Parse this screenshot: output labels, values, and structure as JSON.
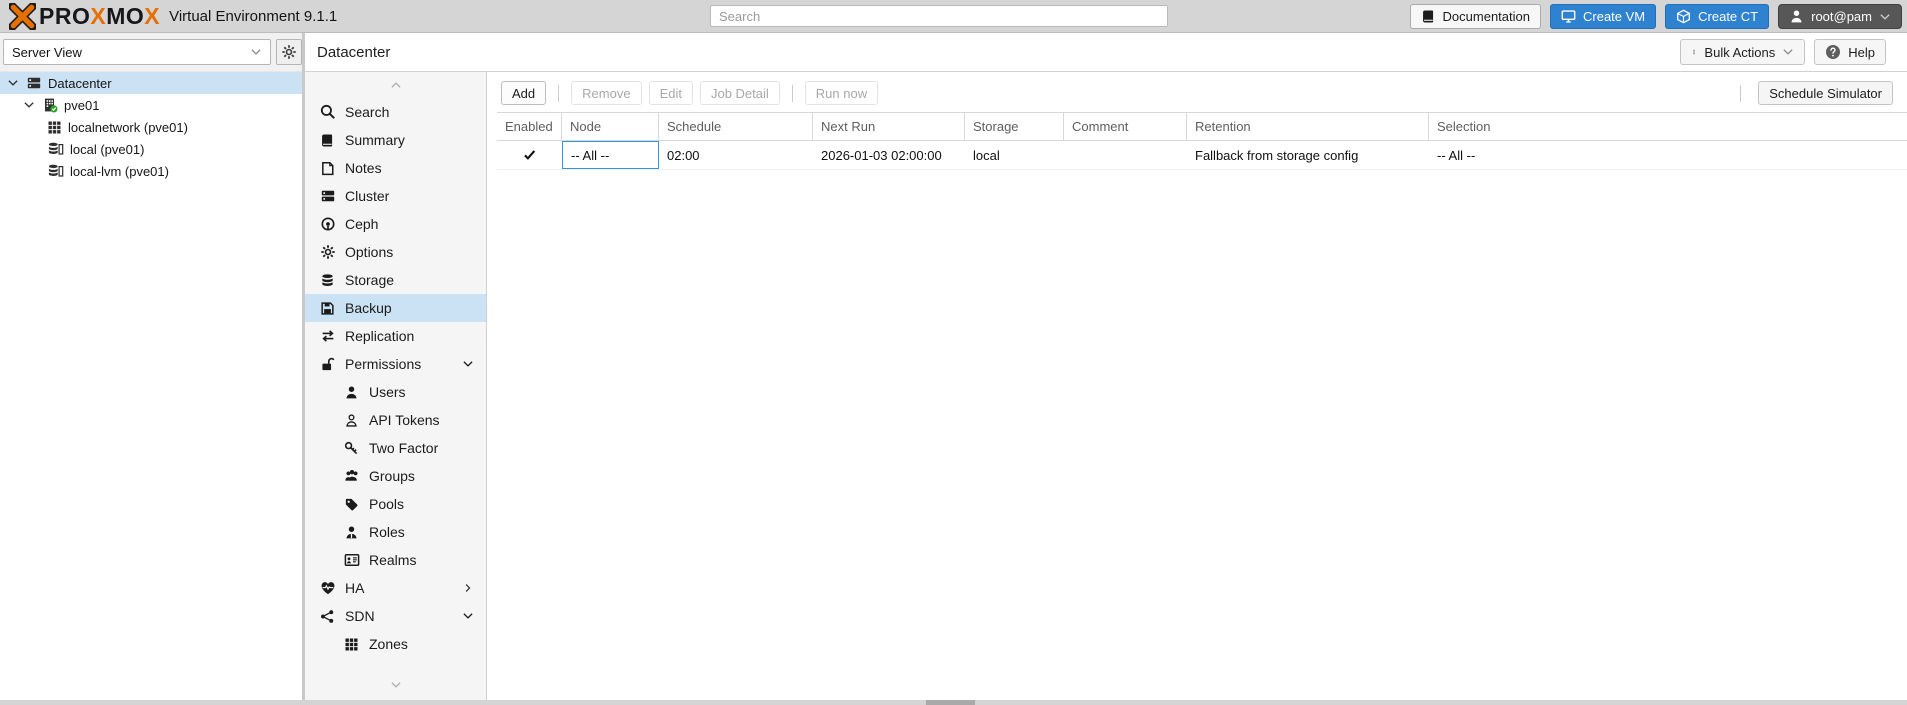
{
  "brand": {
    "logo_mark_icon": "proxmox-x-logo",
    "word_p1": "PRO",
    "word_p2": "X",
    "word_p3": "MO",
    "word_p4": "X",
    "subtitle": "Virtual Environment 9.1.1"
  },
  "topbar": {
    "search_placeholder": "Search",
    "documentation_label": "Documentation",
    "create_vm_label": "Create VM",
    "create_ct_label": "Create CT",
    "user_label": "root@pam"
  },
  "left_panel": {
    "view_selector": "Server View",
    "gear_icon": "gear-icon",
    "tree": [
      {
        "label": "Datacenter",
        "icon": "server-icon",
        "selected": true,
        "expanded": true
      },
      {
        "label": "pve01",
        "icon": "node-online-icon",
        "expanded": true
      },
      {
        "label": "localnetwork (pve01)",
        "icon": "network-grid-icon"
      },
      {
        "label": "local (pve01)",
        "icon": "storage-disk-icon"
      },
      {
        "label": "local-lvm (pve01)",
        "icon": "storage-disk-icon"
      }
    ]
  },
  "content_header": {
    "title": "Datacenter",
    "bulk_actions_label": "Bulk Actions",
    "help_label": "Help"
  },
  "nav": {
    "items": [
      {
        "label": "Search",
        "icon": "search-icon"
      },
      {
        "label": "Summary",
        "icon": "book-icon"
      },
      {
        "label": "Notes",
        "icon": "note-icon"
      },
      {
        "label": "Cluster",
        "icon": "cluster-icon"
      },
      {
        "label": "Ceph",
        "icon": "ceph-icon"
      },
      {
        "label": "Options",
        "icon": "gear-icon"
      },
      {
        "label": "Storage",
        "icon": "storage-icon"
      },
      {
        "label": "Backup",
        "icon": "backup-icon",
        "selected": true
      },
      {
        "label": "Replication",
        "icon": "replication-icon"
      },
      {
        "label": "Permissions",
        "icon": "unlock-icon",
        "arrow": "down"
      },
      {
        "label": "Users",
        "icon": "user-icon",
        "indent": true
      },
      {
        "label": "API Tokens",
        "icon": "user-outline-icon",
        "indent": true
      },
      {
        "label": "Two Factor",
        "icon": "key-icon",
        "indent": true
      },
      {
        "label": "Groups",
        "icon": "users-icon",
        "indent": true
      },
      {
        "label": "Pools",
        "icon": "tag-icon",
        "indent": true
      },
      {
        "label": "Roles",
        "icon": "role-icon",
        "indent": true
      },
      {
        "label": "Realms",
        "icon": "id-card-icon",
        "indent": true
      },
      {
        "label": "HA",
        "icon": "heartbeat-icon",
        "arrow": "right"
      },
      {
        "label": "SDN",
        "icon": "sdn-icon",
        "arrow": "down"
      },
      {
        "label": "Zones",
        "icon": "grid-icon",
        "indent": true
      }
    ]
  },
  "toolbar": {
    "add_label": "Add",
    "remove_label": "Remove",
    "edit_label": "Edit",
    "job_detail_label": "Job Detail",
    "run_now_label": "Run now",
    "schedule_simulator_label": "Schedule Simulator"
  },
  "table": {
    "columns": [
      "Enabled",
      "Node",
      "Schedule",
      "Next Run",
      "Storage",
      "Comment",
      "Retention",
      "Selection"
    ],
    "rows": [
      {
        "enabled": true,
        "enabled_icon": "check-icon",
        "node": "-- All --",
        "schedule": "02:00",
        "next_run": "2026-01-03 02:00:00",
        "storage": "local",
        "comment": "",
        "retention": "Fallback from storage config",
        "selection": "-- All --"
      }
    ]
  },
  "colors": {
    "brand_orange": "#e57000",
    "primary_blue": "#2e82d0",
    "selection_blue": "#cbe2f4",
    "focus_border_blue": "#3292e0",
    "topbar_gray": "#d5d5d5"
  }
}
